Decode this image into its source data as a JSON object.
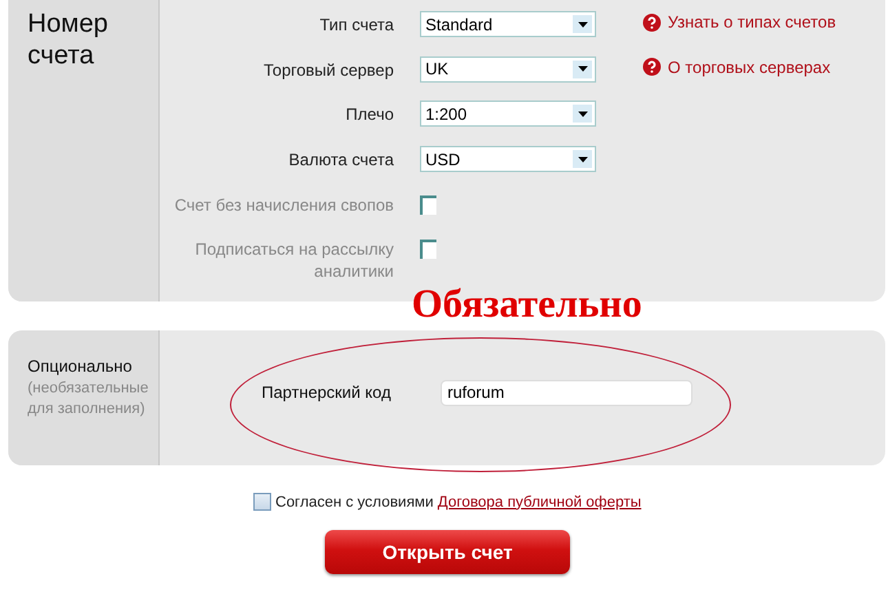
{
  "account_section": {
    "title": "Номер счета",
    "fields": [
      {
        "kind": "select",
        "label": "Тип счета",
        "value": "Standard",
        "disabled": false,
        "help_link": "Узнать о типах счетов"
      },
      {
        "kind": "select",
        "label": "Торговый сервер",
        "value": "UK",
        "disabled": false,
        "help_link": "О торговых серверах"
      },
      {
        "kind": "select",
        "label": "Плечо",
        "value": "1:200",
        "disabled": false
      },
      {
        "kind": "select",
        "label": "Валюта счета",
        "value": "USD",
        "disabled": false
      },
      {
        "kind": "checkbox",
        "label": "Счет без начисления свопов",
        "checked": false,
        "disabled": true
      },
      {
        "kind": "checkbox",
        "label": "Подписаться на рассылку аналитики",
        "checked": false,
        "disabled": true
      }
    ]
  },
  "annotation": {
    "text": "Обязательно"
  },
  "optional_section": {
    "title": "Опционально",
    "subtitle": "(необязательные для заполнения)",
    "partner_label": "Партнерский код",
    "partner_value": "ruforum"
  },
  "agreement": {
    "checked": false,
    "text": "Согласен с условиями",
    "link": "Договора публичной оферты"
  },
  "submit_button": "Открыть счет"
}
